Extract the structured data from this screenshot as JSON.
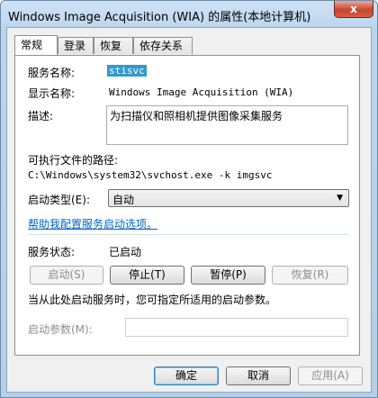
{
  "window": {
    "title": "Windows Image Acquisition (WIA) 的属性(本地计算机)",
    "close_label": "x"
  },
  "tabs": [
    {
      "label": "常规",
      "active": true
    },
    {
      "label": "登录",
      "active": false
    },
    {
      "label": "恢复",
      "active": false
    },
    {
      "label": "依存关系",
      "active": false
    }
  ],
  "general": {
    "service_name_label": "服务名称:",
    "service_name_value": "stisvc",
    "display_name_label": "显示名称:",
    "display_name_value": "Windows Image Acquisition (WIA)",
    "description_label": "描述:",
    "description_value": "为扫描仪和照相机提供图像采集服务",
    "exe_path_label": "可执行文件的路径:",
    "exe_path_value": "C:\\Windows\\system32\\svchost.exe -k imgsvc",
    "startup_type_label": "启动类型(E):",
    "startup_type_value": "自动",
    "help_link": "帮助我配置服务启动选项。",
    "status_label": "服务状态:",
    "status_value": "已启动",
    "start_button": "启动(S)",
    "stop_button": "停止(T)",
    "pause_button": "暂停(P)",
    "resume_button": "恢复(R)",
    "hint_text": "当从此处启动服务时，您可指定所适用的启动参数。",
    "start_params_label": "启动参数(M):",
    "start_params_value": ""
  },
  "footer": {
    "ok_button": "确定",
    "cancel_button": "取消",
    "apply_button": "应用(A)"
  }
}
